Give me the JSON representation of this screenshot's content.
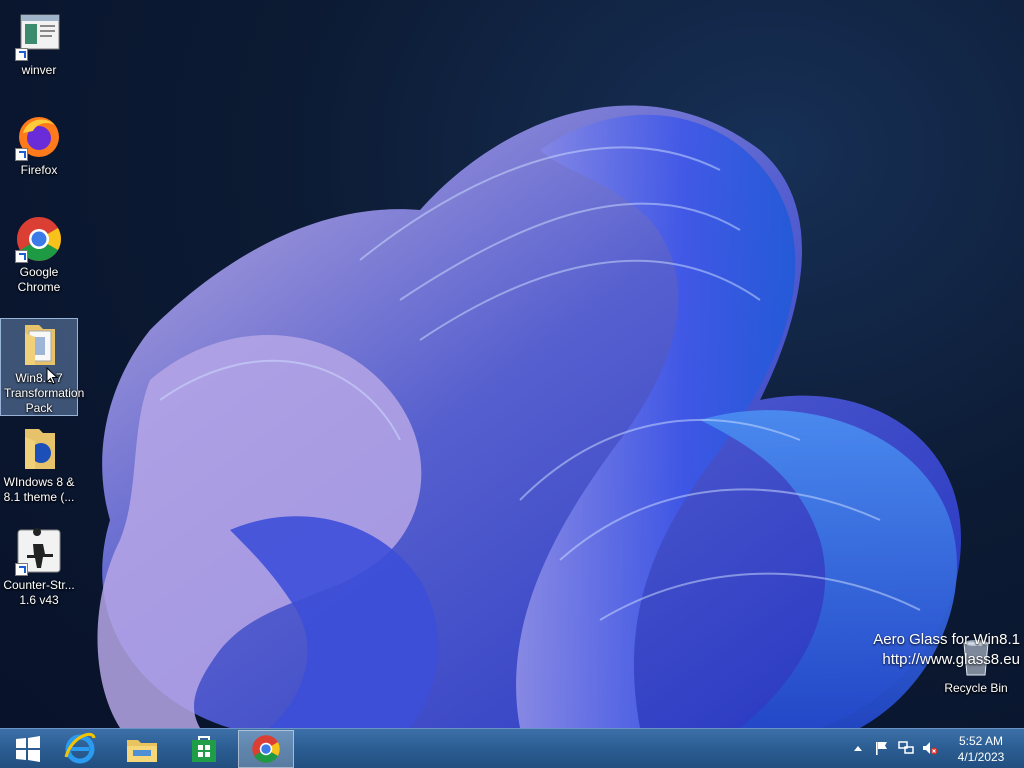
{
  "desktop": {
    "icons": [
      {
        "label": "winver",
        "icon": "winver-app-icon"
      },
      {
        "label": "Firefox",
        "icon": "firefox-icon"
      },
      {
        "label": "Google Chrome",
        "icon": "chrome-icon"
      },
      {
        "label": "Win8.1 7 Transformation Pack",
        "icon": "folder-icon"
      },
      {
        "label": "WIndows 8 & 8.1 theme (...",
        "icon": "folder-icon"
      },
      {
        "label": "Counter-Str... 1.6 v43",
        "icon": "counter-strike-icon"
      }
    ],
    "recycle_bin": {
      "label": "Recycle Bin",
      "icon": "recycle-bin-icon"
    }
  },
  "watermark": {
    "line1": "Aero Glass for Win8.1",
    "line2": "http://www.glass8.eu"
  },
  "taskbar": {
    "pinned": [
      {
        "name": "start",
        "icon": "windows-logo-icon"
      },
      {
        "name": "internet-explorer",
        "icon": "internet-explorer-icon"
      },
      {
        "name": "file-explorer",
        "icon": "file-explorer-icon"
      },
      {
        "name": "store",
        "icon": "store-icon"
      },
      {
        "name": "chrome",
        "icon": "chrome-icon",
        "active": true
      }
    ],
    "tray": {
      "icons": [
        "show-hidden-icons-chevron",
        "action-center-flag-icon",
        "network-icon",
        "volume-muted-icon"
      ],
      "time": "5:52 AM",
      "date": "4/1/2023"
    }
  },
  "colors": {
    "taskbar": "#2b5d92",
    "desktop_bg": "#0c1a33",
    "selection": "#a0c8ff"
  }
}
